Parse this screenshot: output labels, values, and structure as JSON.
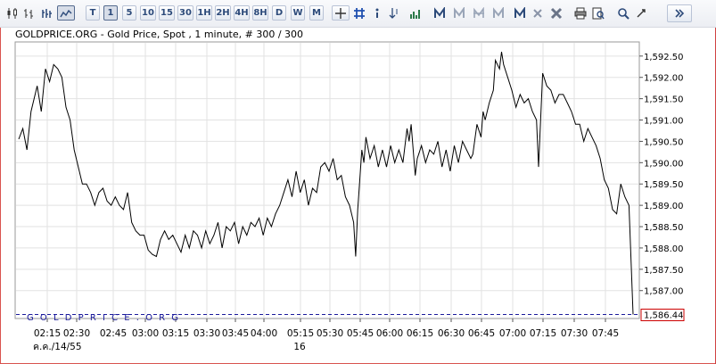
{
  "toolbar": {
    "period_buttons": [
      "T",
      "1",
      "5",
      "10",
      "15",
      "30",
      "1H",
      "2H",
      "4H",
      "8H",
      "D",
      "W",
      "M"
    ],
    "selected_period": "1"
  },
  "colors": {
    "price_line": "#000000",
    "watermark": "#1a1a9c",
    "grid": "#e2e2e2",
    "current_box": "#cc0000"
  },
  "chart_data": {
    "type": "line",
    "title": "GOLDPRICE.ORG - Gold Price, Spot , 1 minute, # 300 / 300",
    "watermark_text": "G O L D P R I C E . O R G",
    "current_price_label": "1,586.44",
    "current_price": 1586.44,
    "ylim": [
      1586.44,
      1592.7
    ],
    "y_ticks": [
      "1,587.00",
      "1,587.50",
      "1,588.00",
      "1,588.50",
      "1,589.00",
      "1,589.50",
      "1,590.00",
      "1,590.50",
      "1,591.00",
      "1,591.50",
      "1,592.00",
      "1,592.50"
    ],
    "x_ticks": [
      "02:15",
      "02:30",
      "02:45",
      "03:00",
      "03:15",
      "03:30",
      "03:45",
      "04:00",
      "05:15",
      "05:30",
      "05:45",
      "06:00",
      "06:15",
      "06:30",
      "06:45",
      "07:00",
      "07:15",
      "07:30",
      "07:45"
    ],
    "x_sublabels": [
      "ค.ค./14/55",
      "16"
    ],
    "series": [
      {
        "values": [
          [
            0,
            1590.55
          ],
          [
            2,
            1590.8
          ],
          [
            4,
            1590.3
          ],
          [
            6,
            1591.2
          ],
          [
            9,
            1591.8
          ],
          [
            11,
            1591.2
          ],
          [
            13,
            1592.2
          ],
          [
            15,
            1591.9
          ],
          [
            17,
            1592.3
          ],
          [
            19,
            1592.2
          ],
          [
            21,
            1592.0
          ],
          [
            23,
            1591.3
          ],
          [
            25,
            1591.0
          ],
          [
            27,
            1590.3
          ],
          [
            29,
            1589.9
          ],
          [
            31,
            1589.5
          ],
          [
            33,
            1589.5
          ],
          [
            35,
            1589.3
          ],
          [
            37,
            1589.0
          ],
          [
            39,
            1589.3
          ],
          [
            41,
            1589.4
          ],
          [
            43,
            1589.1
          ],
          [
            45,
            1589.0
          ],
          [
            47,
            1589.2
          ],
          [
            49,
            1589.0
          ],
          [
            51,
            1588.9
          ],
          [
            53,
            1589.3
          ],
          [
            55,
            1588.6
          ],
          [
            57,
            1588.4
          ],
          [
            59,
            1588.3
          ],
          [
            61,
            1588.3
          ],
          [
            63,
            1587.95
          ],
          [
            65,
            1587.85
          ],
          [
            67,
            1587.8
          ],
          [
            69,
            1588.2
          ],
          [
            71,
            1588.4
          ],
          [
            73,
            1588.2
          ],
          [
            75,
            1588.3
          ],
          [
            77,
            1588.1
          ],
          [
            79,
            1587.9
          ],
          [
            81,
            1588.3
          ],
          [
            83,
            1588.0
          ],
          [
            85,
            1588.4
          ],
          [
            87,
            1588.3
          ],
          [
            89,
            1588.0
          ],
          [
            91,
            1588.4
          ],
          [
            93,
            1588.1
          ],
          [
            95,
            1588.3
          ],
          [
            97,
            1588.6
          ],
          [
            99,
            1588.0
          ],
          [
            101,
            1588.5
          ],
          [
            103,
            1588.4
          ],
          [
            105,
            1588.6
          ],
          [
            107,
            1588.1
          ],
          [
            109,
            1588.5
          ],
          [
            111,
            1588.3
          ],
          [
            113,
            1588.6
          ],
          [
            115,
            1588.5
          ],
          [
            117,
            1588.7
          ],
          [
            119,
            1588.3
          ],
          [
            121,
            1588.7
          ],
          [
            123,
            1588.5
          ],
          [
            125,
            1588.8
          ],
          [
            127,
            1589.0
          ],
          [
            129,
            1589.3
          ],
          [
            131,
            1589.6
          ],
          [
            133,
            1589.2
          ],
          [
            135,
            1589.8
          ],
          [
            137,
            1589.3
          ],
          [
            139,
            1589.6
          ],
          [
            141,
            1589.0
          ],
          [
            143,
            1589.4
          ],
          [
            145,
            1589.3
          ],
          [
            147,
            1589.9
          ],
          [
            149,
            1590.0
          ],
          [
            151,
            1589.8
          ],
          [
            153,
            1590.1
          ],
          [
            155,
            1589.6
          ],
          [
            157,
            1589.7
          ],
          [
            159,
            1589.2
          ],
          [
            161,
            1589.0
          ],
          [
            163,
            1588.6
          ],
          [
            164,
            1587.8
          ],
          [
            165,
            1588.9
          ],
          [
            167,
            1590.3
          ],
          [
            168,
            1590.0
          ],
          [
            169,
            1590.6
          ],
          [
            171,
            1590.1
          ],
          [
            173,
            1590.4
          ],
          [
            175,
            1589.9
          ],
          [
            177,
            1590.3
          ],
          [
            179,
            1589.9
          ],
          [
            181,
            1590.4
          ],
          [
            183,
            1590.0
          ],
          [
            185,
            1590.3
          ],
          [
            187,
            1590.0
          ],
          [
            189,
            1590.8
          ],
          [
            190,
            1590.5
          ],
          [
            191,
            1590.9
          ],
          [
            192,
            1590.3
          ],
          [
            193,
            1589.7
          ],
          [
            194,
            1590.1
          ],
          [
            196,
            1590.4
          ],
          [
            198,
            1590.0
          ],
          [
            200,
            1590.3
          ],
          [
            202,
            1590.2
          ],
          [
            204,
            1590.5
          ],
          [
            206,
            1589.9
          ],
          [
            208,
            1590.3
          ],
          [
            210,
            1589.8
          ],
          [
            212,
            1590.4
          ],
          [
            214,
            1590.0
          ],
          [
            216,
            1590.5
          ],
          [
            218,
            1590.3
          ],
          [
            220,
            1590.1
          ],
          [
            221,
            1590.2
          ],
          [
            223,
            1590.9
          ],
          [
            225,
            1590.6
          ],
          [
            226,
            1591.2
          ],
          [
            227,
            1591.0
          ],
          [
            229,
            1591.4
          ],
          [
            231,
            1591.7
          ],
          [
            232,
            1592.4
          ],
          [
            234,
            1592.2
          ],
          [
            235,
            1592.6
          ],
          [
            236,
            1592.3
          ],
          [
            238,
            1592.0
          ],
          [
            240,
            1591.7
          ],
          [
            242,
            1591.3
          ],
          [
            244,
            1591.6
          ],
          [
            246,
            1591.4
          ],
          [
            248,
            1591.5
          ],
          [
            250,
            1591.2
          ],
          [
            252,
            1591.0
          ],
          [
            253,
            1589.9
          ],
          [
            254,
            1591.0
          ],
          [
            255,
            1592.1
          ],
          [
            257,
            1591.8
          ],
          [
            259,
            1591.7
          ],
          [
            261,
            1591.4
          ],
          [
            263,
            1591.6
          ],
          [
            265,
            1591.6
          ],
          [
            267,
            1591.4
          ],
          [
            269,
            1591.2
          ],
          [
            271,
            1590.9
          ],
          [
            273,
            1590.9
          ],
          [
            275,
            1590.5
          ],
          [
            277,
            1590.8
          ],
          [
            279,
            1590.6
          ],
          [
            281,
            1590.4
          ],
          [
            283,
            1590.1
          ],
          [
            285,
            1589.6
          ],
          [
            287,
            1589.4
          ],
          [
            289,
            1588.9
          ],
          [
            291,
            1588.8
          ],
          [
            293,
            1589.5
          ],
          [
            295,
            1589.2
          ],
          [
            297,
            1589.0
          ],
          [
            299,
            1586.44
          ]
        ]
      }
    ]
  }
}
